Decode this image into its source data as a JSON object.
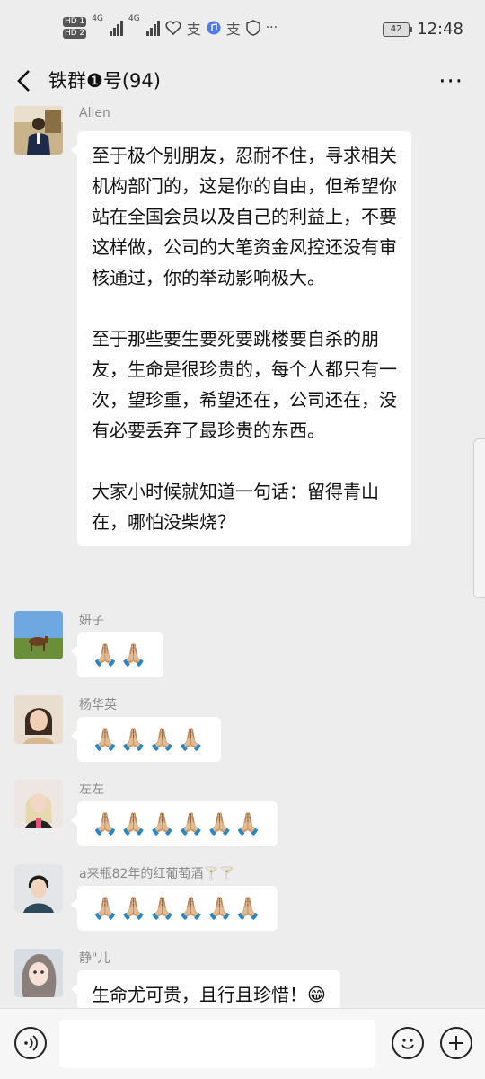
{
  "status_bar": {
    "left_badges": [
      "HD 1",
      "HD 2"
    ],
    "signal_labels": [
      "4G",
      "4G"
    ],
    "extra_icons": [
      "heart-icon",
      "alipay-icon",
      "music-icon",
      "alipay-icon",
      "shield-icon"
    ],
    "more": "···",
    "battery": "42",
    "time": "12:48"
  },
  "header": {
    "title": "铁群❶号(94)",
    "more_label": "···"
  },
  "messages": [
    {
      "sender": "Allen",
      "paragraphs": [
        "至于极个别朋友，忍耐不住，寻求相关机构部门的，这是你的自由，但希望你站在全国会员以及自己的利益上，不要这样做，公司的大笔资金风控还没有审核通过，你的举动影响极大。",
        "至于那些要生要死要跳楼要自杀的朋友，生命是很珍贵的，每个人都只有一次，望珍重，希望还在，公司还在，没有必要丢弃了最珍贵的东西。",
        "大家小时候就知道一句话：留得青山在，哪怕没柴烧？"
      ]
    },
    {
      "sender": "妍子",
      "text": "🙏🏼🙏🏼"
    },
    {
      "sender": "杨华英",
      "text": "🙏🏼🙏🏼🙏🏼🙏🏼"
    },
    {
      "sender": "左左",
      "text": "🙏🏼🙏🏼🙏🏼🙏🏼🙏🏼🙏🏼"
    },
    {
      "sender": "a来瓶82年的红葡萄酒🍸🍸",
      "text": "🙏🏼🙏🏼🙏🏼🙏🏼🙏🏼🙏🏼"
    },
    {
      "sender": "静\"儿",
      "text": "生命尤可贵，且行且珍惜！😁"
    }
  ],
  "input": {
    "value": "",
    "placeholder": ""
  },
  "colors": {
    "background": "#ededed",
    "bubble": "#ffffff",
    "sender_text": "#8a8a8a"
  }
}
